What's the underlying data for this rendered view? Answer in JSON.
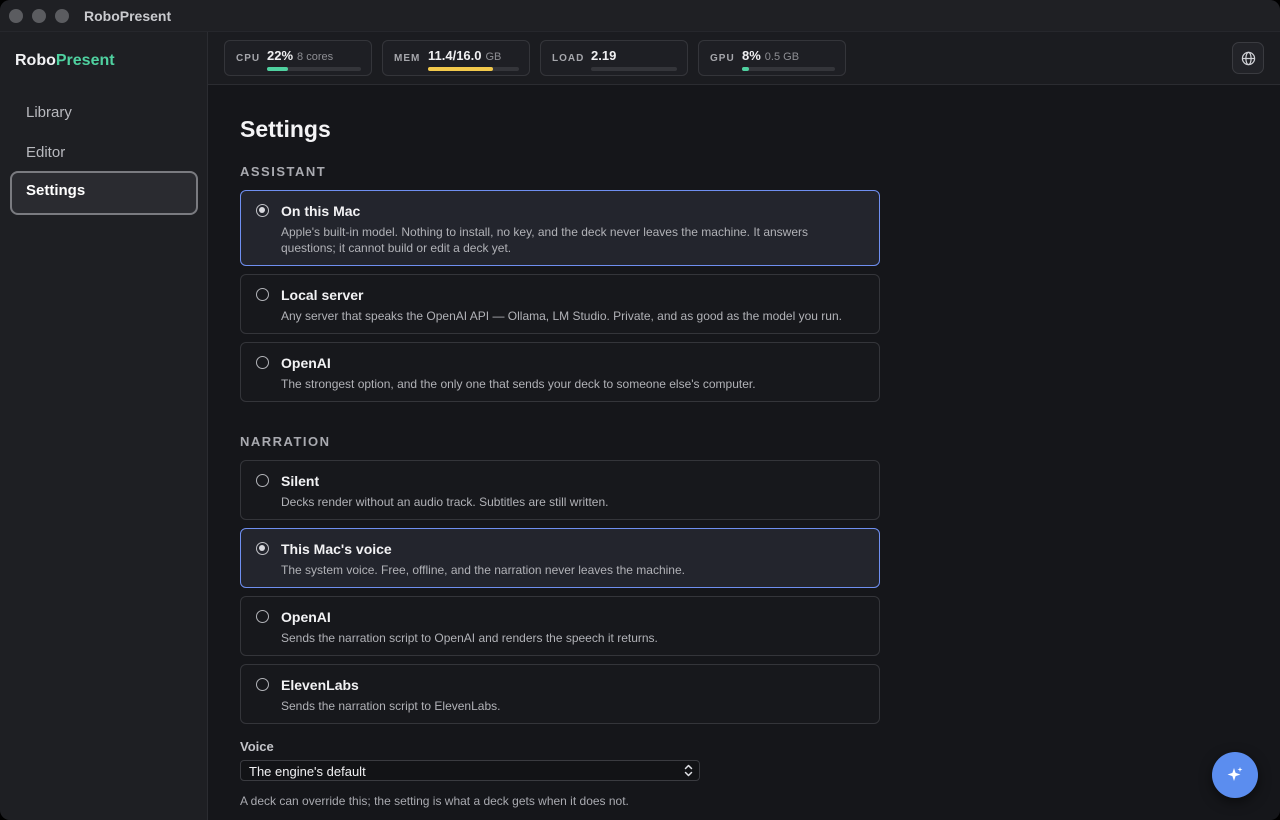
{
  "window": {
    "title": "RoboPresent"
  },
  "sidebar": {
    "brand_part1": "Robo",
    "brand_part2": "Present",
    "items": [
      {
        "label": "Library",
        "active": false
      },
      {
        "label": "Editor",
        "active": false
      },
      {
        "label": "Settings",
        "active": true
      }
    ]
  },
  "stats": {
    "cpu": {
      "label": "CPU",
      "value": "22%",
      "sub": "8 cores",
      "progress": 0.22,
      "color": "#4fd1a0"
    },
    "mem": {
      "label": "MEM",
      "value": "11.4/16.0",
      "sub": "GB",
      "progress": 0.71,
      "color": "#f2c94c"
    },
    "load": {
      "label": "LOAD",
      "value": "2.19",
      "sub": "",
      "progress": 0.0,
      "color": "#4fd1a0"
    },
    "gpu": {
      "label": "GPU",
      "value": "8%",
      "sub": "0.5 GB",
      "progress": 0.08,
      "color": "#4fd1a0"
    }
  },
  "settings": {
    "title": "Settings",
    "assistant": {
      "heading": "ASSISTANT",
      "options": [
        {
          "title": "On this Mac",
          "desc": "Apple's built-in model. Nothing to install, no key, and the deck never leaves the machine. It answers questions; it cannot build or edit a deck yet.",
          "selected": true
        },
        {
          "title": "Local server",
          "desc": "Any server that speaks the OpenAI API — Ollama, LM Studio. Private, and as good as the model you run.",
          "selected": false
        },
        {
          "title": "OpenAI",
          "desc": "The strongest option, and the only one that sends your deck to someone else's computer.",
          "selected": false
        }
      ]
    },
    "narration": {
      "heading": "NARRATION",
      "options": [
        {
          "title": "Silent",
          "desc": "Decks render without an audio track. Subtitles are still written.",
          "selected": false
        },
        {
          "title": "This Mac's voice",
          "desc": "The system voice. Free, offline, and the narration never leaves the machine.",
          "selected": true
        },
        {
          "title": "OpenAI",
          "desc": "Sends the narration script to OpenAI and renders the speech it returns.",
          "selected": false
        },
        {
          "title": "ElevenLabs",
          "desc": "Sends the narration script to ElevenLabs.",
          "selected": false
        }
      ]
    },
    "voice": {
      "label": "Voice",
      "selected": "The engine's default",
      "hint": "A deck can override this; the setting is what a deck gets when it does not."
    }
  },
  "icons": {
    "globe": "globe-icon",
    "assistant": "sparkle-icon",
    "select": "chevron-up-down-icon"
  }
}
